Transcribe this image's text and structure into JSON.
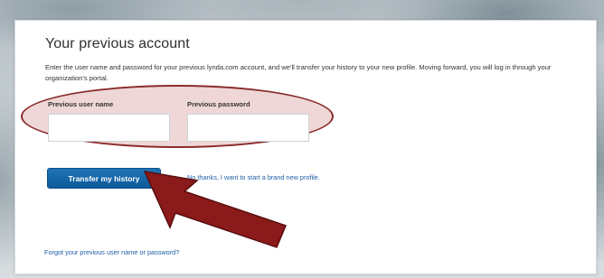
{
  "panel": {
    "title": "Your previous account",
    "description": "Enter the user name and password for your previous lynda.com account, and we'll transfer your history to your new profile. Moving forward, you will log in through your organization's portal."
  },
  "form": {
    "username_label": "Previous user name",
    "username_value": "",
    "password_label": "Previous password",
    "password_value": ""
  },
  "actions": {
    "transfer_button": "Transfer my history",
    "no_thanks_link": "No thanks, I want to start a brand new profile.",
    "forgot_link": "Forgot your previous user name or password?"
  },
  "annotations": {
    "ellipse_color": "#8a2b2b",
    "arrow_color": "#8b1a1a"
  },
  "colors": {
    "button_blue": "#1668a8",
    "link_blue": "#1d5fa8"
  }
}
